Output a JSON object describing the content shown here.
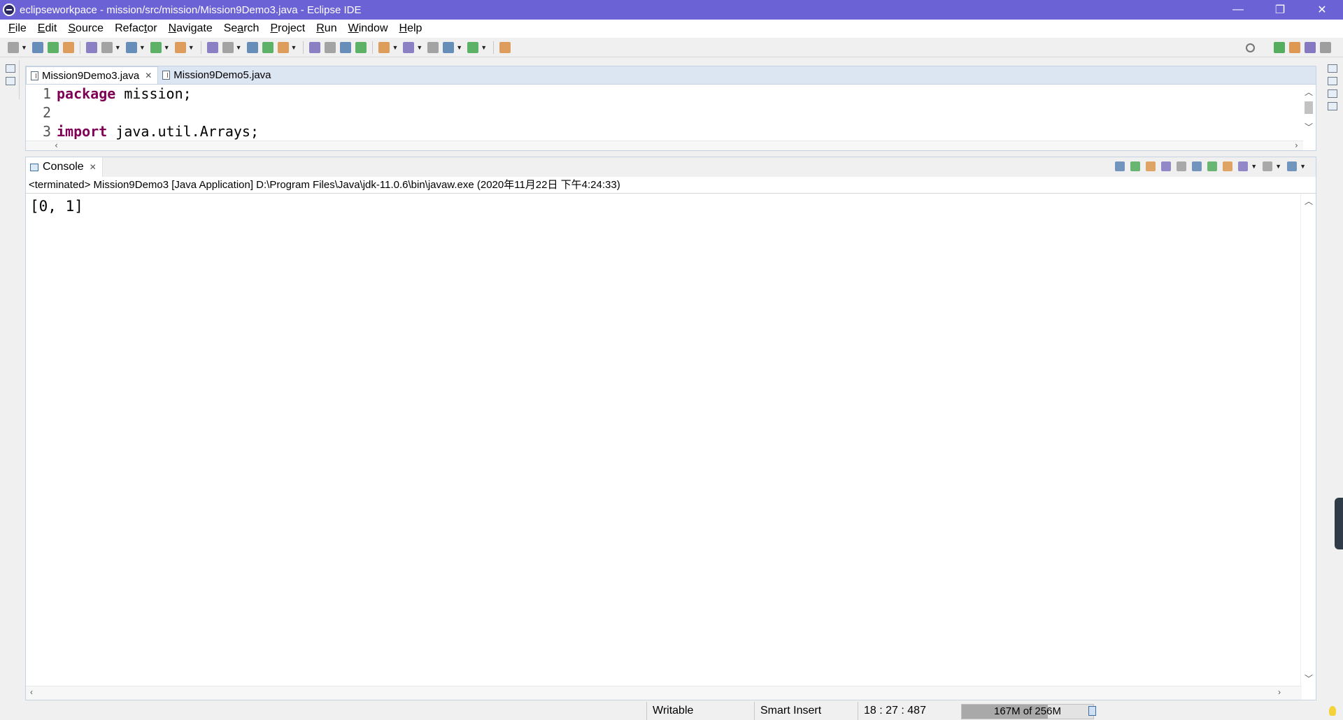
{
  "window": {
    "title": "eclipseworkpace - mission/src/mission/Mission9Demo3.java - Eclipse IDE",
    "minimize_glyph": "—",
    "restore_glyph": "❐",
    "close_glyph": "✕"
  },
  "menu": [
    {
      "mnemonic": "F",
      "rest": "ile"
    },
    {
      "mnemonic": "E",
      "rest": "dit"
    },
    {
      "mnemonic": "S",
      "rest": "ource"
    },
    {
      "prefix": "Refac",
      "mnemonic": "t",
      "rest": "or"
    },
    {
      "mnemonic": "N",
      "rest": "avigate"
    },
    {
      "prefix": "Se",
      "mnemonic": "a",
      "rest": "rch"
    },
    {
      "mnemonic": "P",
      "rest": "roject"
    },
    {
      "mnemonic": "R",
      "rest": "un"
    },
    {
      "mnemonic": "W",
      "rest": "indow"
    },
    {
      "mnemonic": "H",
      "rest": "elp"
    }
  ],
  "toolbar": {
    "icons": [
      "new-icon",
      "save-icon",
      "save-all-icon",
      "terminal-icon",
      "skip-breakpoints-icon",
      "debug-icon",
      "run-icon",
      "coverage-icon",
      "external-tools-icon",
      "new-java-package-icon",
      "new-java-class-icon",
      "open-type-icon",
      "open-task-icon",
      "search-icon",
      "toggle-mark-occurrences-icon",
      "highlight-icon",
      "toggle-block-icon",
      "show-whitespace-icon",
      "next-annotation-icon",
      "previous-annotation-icon",
      "last-edit-icon",
      "back-icon",
      "forward-icon",
      "pin-editor-icon"
    ],
    "right_icons": [
      "quick-access-search-icon",
      "open-perspective-icon",
      "java-ee-perspective-icon",
      "java-perspective-icon",
      "debug-perspective-icon"
    ],
    "colors": {
      "green": "#2e9d3a",
      "blue": "#3a6ea5",
      "orange": "#d9822b",
      "gray": "#8a8a8a",
      "purple": "#6b5bb5"
    }
  },
  "editor": {
    "tabs": [
      {
        "label": "Mission9Demo3.java",
        "active": true
      },
      {
        "label": "Mission9Demo5.java",
        "active": false
      }
    ],
    "lines": [
      {
        "num": "1",
        "kw": "package",
        "text": " mission;"
      },
      {
        "num": "2",
        "kw": "",
        "text": ""
      },
      {
        "num": "3",
        "kw": "import",
        "text": " java.util.Arrays;"
      }
    ],
    "keyword_color": "#7f0055"
  },
  "console": {
    "tab_label": "Console",
    "description": "<terminated> Mission9Demo3 [Java Application] D:\\Program Files\\Java\\jdk-11.0.6\\bin\\javaw.exe (2020年11月22日 下午4:24:33)",
    "output": "[0, 1]",
    "tool_icons": [
      "terminate-icon",
      "remove-launch-icon",
      "remove-all-terminated-icon",
      "clear-console-icon",
      "scroll-lock-icon",
      "word-wrap-icon",
      "show-on-stdout-icon",
      "show-on-stderr-icon",
      "pin-console-icon",
      "display-selected-console-icon",
      "open-console-icon"
    ]
  },
  "status": {
    "writable": "Writable",
    "insert_mode": "Smart Insert",
    "position": "18 : 27 : 487",
    "heap": "167M of 256M",
    "heap_used_fraction": 0.652
  }
}
